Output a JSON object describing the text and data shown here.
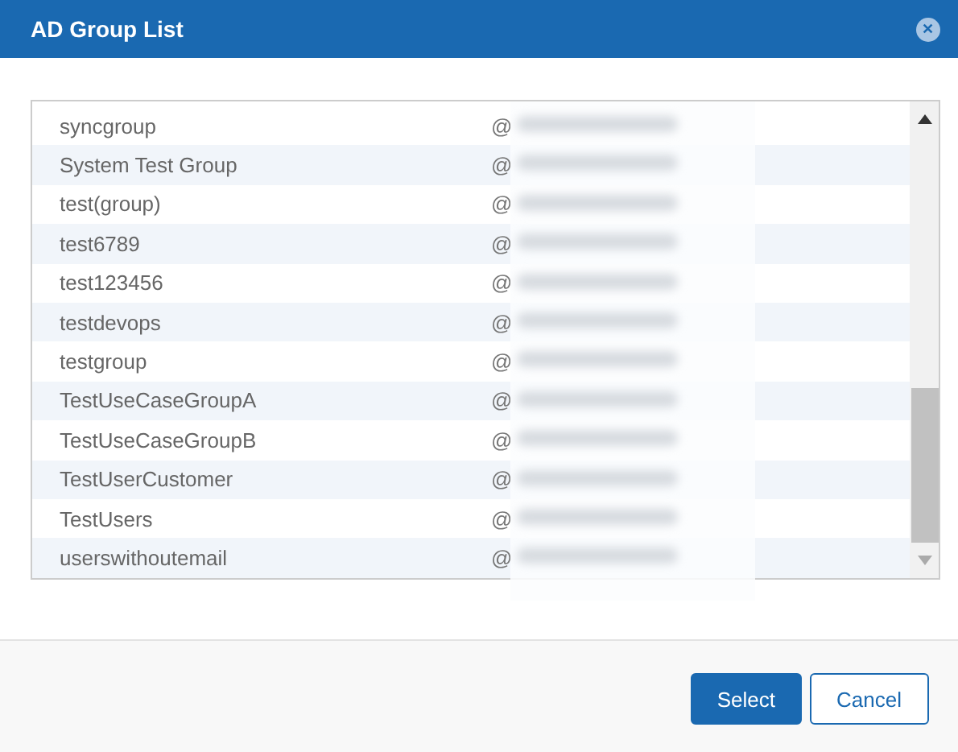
{
  "window": {
    "title": "AD Group List",
    "close": "✕"
  },
  "rows": [
    {
      "name": "syncgroup",
      "email": "@"
    },
    {
      "name": "System Test Group",
      "email": "@"
    },
    {
      "name": "test(group)",
      "email": "@"
    },
    {
      "name": "test6789",
      "email": "@"
    },
    {
      "name": "test123456",
      "email": "@"
    },
    {
      "name": "testdevops",
      "email": "@"
    },
    {
      "name": "testgroup",
      "email": "@"
    },
    {
      "name": "TestUseCaseGroupA",
      "email": "@"
    },
    {
      "name": "TestUseCaseGroupB",
      "email": "@"
    },
    {
      "name": "TestUserCustomer",
      "email": "@"
    },
    {
      "name": "TestUsers",
      "email": "@"
    },
    {
      "name": "userswithoutemail",
      "email": "@"
    }
  ],
  "buttons": [
    {
      "label": "Select",
      "kind": "primary"
    },
    {
      "label": "Cancel",
      "kind": "secondary"
    }
  ]
}
